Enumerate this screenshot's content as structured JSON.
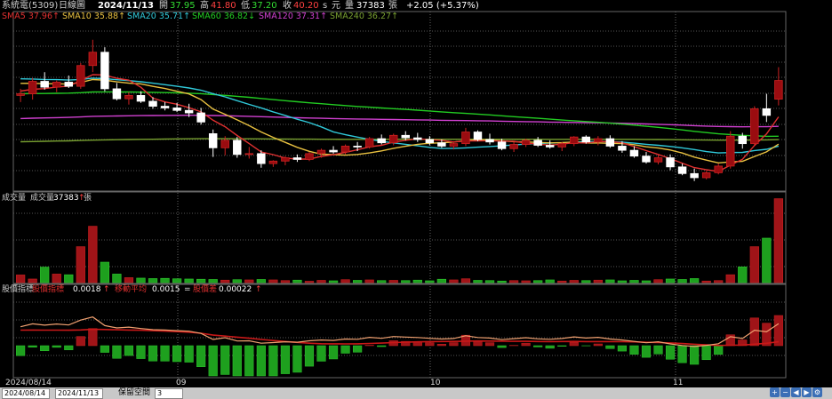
{
  "header": {
    "stock": "系統電(5309)",
    "period": "日線圖",
    "date": "2024/11/13",
    "open_label": "開",
    "open": "37.95",
    "high_label": "高",
    "high": "41.80",
    "low_label": "低",
    "low": "37.20",
    "close_label": "收",
    "close": "40.20",
    "unit_s": "s",
    "currency": "元",
    "vol_label": "量",
    "vol": "37383",
    "vol_unit": "張",
    "change": "+2.05 (+5.37%)"
  },
  "ma_legend": [
    {
      "name": "SMA5",
      "value": "37.96",
      "arrow": "↑",
      "color": "#e03030"
    },
    {
      "name": "SMA10",
      "value": "35.88",
      "arrow": "↑",
      "color": "#e8c040"
    },
    {
      "name": "SMA20",
      "value": "35.71",
      "arrow": "↑",
      "color": "#30c8d8"
    },
    {
      "name": "SMA60",
      "value": "36.82",
      "arrow": "↓",
      "color": "#22cc22"
    },
    {
      "name": "SMA120",
      "value": "37.31",
      "arrow": "↑",
      "color": "#d040d0"
    },
    {
      "name": "SMA240",
      "value": "36.27",
      "arrow": "↑",
      "color": "#78a030"
    }
  ],
  "volume_legend": {
    "title": "成交量",
    "label": "成交量",
    "value": "37383",
    "arrow": "↑",
    "unit": "張"
  },
  "osc_legend": {
    "title": "股價指標",
    "items": [
      {
        "label": "股價指標",
        "value": "0.0018",
        "arrow": "↑",
        "color": "#e03030"
      },
      {
        "label": "移動平均",
        "value": "0.0015",
        "arrow": "=",
        "color": "#e03030"
      },
      {
        "label": "股價差",
        "value": "0.00022",
        "arrow": "↑",
        "color": "#e03030"
      }
    ]
  },
  "x_labels": [
    "2024/08/14",
    "09",
    "10",
    "11"
  ],
  "bottom": {
    "from": "2024/08/14",
    "to": "2024/11/13",
    "mode": "保留空間",
    "spaces": "3"
  },
  "chart_data": {
    "type": "candlestick",
    "ohlc": [
      [
        38.4,
        39.2,
        37.6,
        38.6
      ],
      [
        38.6,
        40.5,
        37.9,
        40.1
      ],
      [
        40.1,
        41.2,
        39.1,
        39.4
      ],
      [
        39.4,
        40.2,
        38.8,
        40.0
      ],
      [
        40.0,
        40.8,
        39.3,
        39.5
      ],
      [
        39.5,
        42.3,
        39.2,
        42.0
      ],
      [
        42.0,
        45.1,
        41.2,
        43.6
      ],
      [
        43.6,
        44.2,
        38.9,
        39.2
      ],
      [
        39.2,
        39.9,
        37.8,
        38.0
      ],
      [
        38.0,
        38.8,
        37.3,
        38.4
      ],
      [
        38.4,
        38.9,
        37.5,
        37.7
      ],
      [
        37.7,
        38.2,
        36.8,
        37.1
      ],
      [
        37.1,
        37.6,
        36.6,
        36.9
      ],
      [
        36.9,
        37.5,
        36.4,
        36.6
      ],
      [
        36.6,
        37.4,
        35.8,
        36.3
      ],
      [
        36.3,
        36.9,
        34.9,
        35.2
      ],
      [
        33.8,
        34.3,
        31.0,
        32.1
      ],
      [
        32.1,
        33.5,
        31.2,
        33.0
      ],
      [
        33.0,
        33.4,
        30.9,
        31.3
      ],
      [
        31.3,
        32.2,
        30.8,
        31.4
      ],
      [
        31.4,
        31.8,
        29.7,
        30.2
      ],
      [
        30.2,
        30.6,
        29.8,
        30.5
      ],
      [
        30.5,
        31.1,
        30.0,
        30.9
      ],
      [
        30.9,
        31.3,
        30.4,
        30.7
      ],
      [
        30.7,
        31.6,
        30.5,
        31.4
      ],
      [
        31.4,
        32.0,
        30.9,
        31.8
      ],
      [
        31.8,
        32.3,
        31.4,
        31.6
      ],
      [
        31.6,
        32.5,
        31.3,
        32.3
      ],
      [
        32.3,
        32.8,
        31.7,
        32.2
      ],
      [
        32.2,
        33.4,
        32.0,
        33.2
      ],
      [
        33.2,
        33.7,
        32.5,
        32.7
      ],
      [
        32.7,
        33.8,
        32.4,
        33.6
      ],
      [
        33.6,
        34.1,
        33.0,
        33.3
      ],
      [
        33.3,
        33.9,
        32.8,
        33.1
      ],
      [
        33.1,
        33.5,
        32.4,
        32.7
      ],
      [
        32.7,
        33.1,
        32.1,
        32.3
      ],
      [
        32.3,
        32.9,
        31.9,
        32.6
      ],
      [
        32.6,
        34.5,
        32.3,
        34.0
      ],
      [
        34.0,
        34.2,
        32.9,
        33.1
      ],
      [
        33.1,
        33.8,
        32.5,
        32.8
      ],
      [
        32.8,
        33.2,
        31.8,
        32.0
      ],
      [
        32.0,
        32.8,
        31.6,
        32.5
      ],
      [
        32.5,
        33.2,
        32.2,
        33.0
      ],
      [
        33.0,
        33.4,
        32.2,
        32.4
      ],
      [
        32.4,
        33.0,
        32.0,
        32.2
      ],
      [
        32.2,
        32.8,
        31.7,
        32.6
      ],
      [
        32.6,
        33.5,
        32.3,
        33.4
      ],
      [
        33.4,
        33.6,
        32.6,
        32.8
      ],
      [
        32.8,
        33.5,
        32.4,
        33.2
      ],
      [
        33.2,
        33.6,
        32.1,
        32.3
      ],
      [
        32.3,
        32.9,
        31.5,
        31.8
      ],
      [
        31.8,
        32.3,
        30.9,
        31.1
      ],
      [
        31.1,
        31.6,
        30.2,
        30.4
      ],
      [
        30.4,
        31.3,
        30.1,
        30.9
      ],
      [
        30.9,
        31.3,
        29.4,
        29.8
      ],
      [
        29.8,
        30.2,
        28.8,
        29.0
      ],
      [
        29.0,
        29.6,
        28.1,
        28.5
      ],
      [
        28.5,
        29.3,
        28.3,
        29.1
      ],
      [
        29.1,
        30.2,
        28.9,
        29.9
      ],
      [
        29.9,
        34.1,
        29.6,
        33.5
      ],
      [
        33.5,
        33.9,
        32.0,
        32.6
      ],
      [
        32.6,
        37.1,
        32.4,
        36.8
      ],
      [
        36.8,
        38.6,
        35.2,
        36.0
      ],
      [
        37.95,
        41.8,
        37.2,
        40.2
      ]
    ],
    "volume": [
      3400,
      1600,
      6900,
      3800,
      3500,
      16000,
      25100,
      9100,
      3800,
      2200,
      2000,
      1800,
      1900,
      1700,
      1600,
      1500,
      1400,
      1100,
      1300,
      1200,
      1400,
      1200,
      900,
      1100,
      600,
      1000,
      800,
      1300,
      1000,
      1200,
      900,
      1000,
      900,
      1100,
      800,
      1500,
      1200,
      1700,
      1000,
      900,
      700,
      900,
      800,
      900,
      1200,
      700,
      1000,
      900,
      1100,
      1200,
      800,
      1000,
      800,
      1300,
      1600,
      1400,
      1800,
      700,
      900,
      3500,
      7000,
      16000,
      19800,
      37383
    ],
    "ylim": [
      27,
      47
    ],
    "volume_max": 38000
  }
}
